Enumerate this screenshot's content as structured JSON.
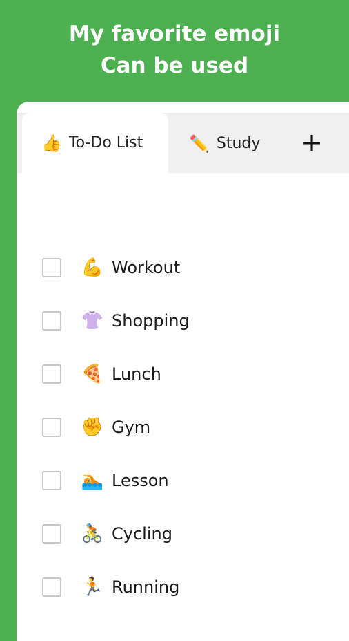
{
  "header": {
    "line1": "My favorite emoji",
    "line2": "Can be used"
  },
  "tabs": [
    {
      "emoji": "👍",
      "label": "To-Do List",
      "active": true
    },
    {
      "emoji": "✏️",
      "label": "Study",
      "active": false
    }
  ],
  "add_tab_label": "+",
  "todo_items": [
    {
      "emoji": "💪",
      "label": "Workout",
      "checked": false
    },
    {
      "emoji": "👚",
      "label": "Shopping",
      "checked": false
    },
    {
      "emoji": "🍕",
      "label": "Lunch",
      "checked": false
    },
    {
      "emoji": "✊",
      "label": "Gym",
      "checked": false
    },
    {
      "emoji": "🏊",
      "label": "Lesson",
      "checked": false
    },
    {
      "emoji": "🚴",
      "label": "Cycling",
      "checked": false
    },
    {
      "emoji": "🏃",
      "label": "Running",
      "checked": false
    }
  ],
  "colors": {
    "background": "#4caf50",
    "card": "#ffffff",
    "tab_strip": "#f0f0f0",
    "checkbox_border": "#c8c8c8"
  }
}
